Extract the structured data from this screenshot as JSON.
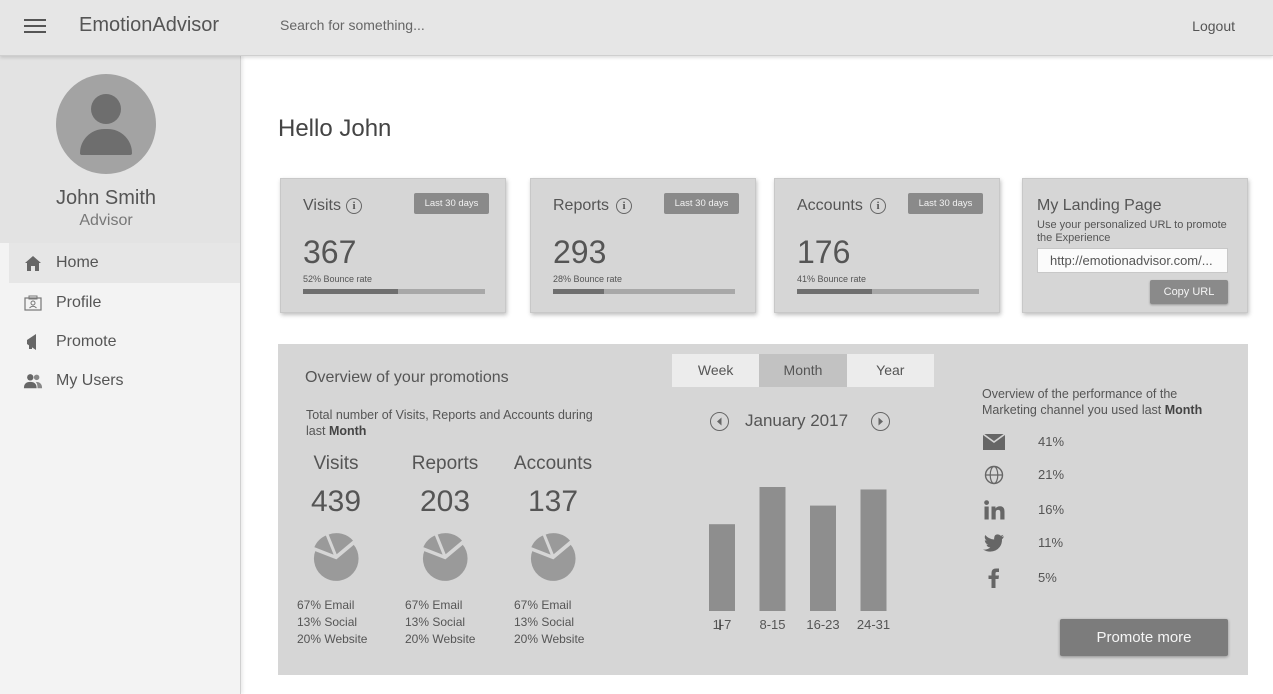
{
  "app": {
    "brand": "EmotionAdvisor",
    "search_placeholder": "Search for something...",
    "logout_label": "Logout"
  },
  "user": {
    "name": "John Smith",
    "role": "Advisor"
  },
  "sidebar": {
    "items": [
      {
        "label": "Home",
        "icon": "home-icon",
        "active": true
      },
      {
        "label": "Profile",
        "icon": "profile-card-icon",
        "active": false
      },
      {
        "label": "Promote",
        "icon": "megaphone-icon",
        "active": false
      },
      {
        "label": "My Users",
        "icon": "users-icon",
        "active": false
      }
    ]
  },
  "greeting": "Hello John",
  "cards": [
    {
      "title": "Visits",
      "badge": "Last 30 days",
      "value": "367",
      "sub": "52% Bounce rate",
      "bounce_fraction": 0.52
    },
    {
      "title": "Reports",
      "badge": "Last 30 days",
      "value": "293",
      "sub": "28% Bounce rate",
      "bounce_fraction": 0.28
    },
    {
      "title": "Accounts",
      "badge": "Last 30 days",
      "value": "176",
      "sub": "41% Bounce rate",
      "bounce_fraction": 0.41
    }
  ],
  "landing": {
    "title": "My Landing Page",
    "description": "Use your personalized URL to promote the Experience",
    "url_value": "http://emotionadvisor.com/...",
    "copy_label": "Copy URL"
  },
  "overview": {
    "title": "Overview of your promotions",
    "desc_prefix": "Total number of Visits, Reports and Accounts during last ",
    "desc_period": "Month",
    "metrics": [
      {
        "label": "Visits",
        "value": "439",
        "breakdown": [
          "67% Email",
          "13% Social",
          "20% Website"
        ]
      },
      {
        "label": "Reports",
        "value": "203",
        "breakdown": [
          "67% Email",
          "13% Social",
          "20% Website"
        ]
      },
      {
        "label": "Accounts",
        "value": "137",
        "breakdown": [
          "67% Email",
          "13% Social",
          "20% Website"
        ]
      }
    ],
    "pie_shares": [
      67,
      13,
      20
    ],
    "tabs": [
      {
        "label": "Week",
        "active": false
      },
      {
        "label": "Month",
        "active": true
      },
      {
        "label": "Year",
        "active": false
      }
    ],
    "calendar_month": "January 2017",
    "chart_data": {
      "type": "bar",
      "categories": [
        "1-7",
        "8-15",
        "16-23",
        "24-31"
      ],
      "values": [
        70,
        100,
        85,
        98
      ]
    },
    "channels_desc_prefix": "Overview of the performance of the Marketing channel you used last ",
    "channels_desc_period": "Month",
    "channels": [
      {
        "icon": "email-icon",
        "pct": "41%"
      },
      {
        "icon": "globe-icon",
        "pct": "21%"
      },
      {
        "icon": "linkedin-icon",
        "pct": "16%"
      },
      {
        "icon": "twitter-icon",
        "pct": "11%"
      },
      {
        "icon": "facebook-icon",
        "pct": "5%"
      }
    ],
    "promote_label": "Promote more"
  },
  "colors": {
    "bar": "#8e8e8e",
    "panel": "#d6d6d6",
    "button": "#7c7c7c"
  }
}
